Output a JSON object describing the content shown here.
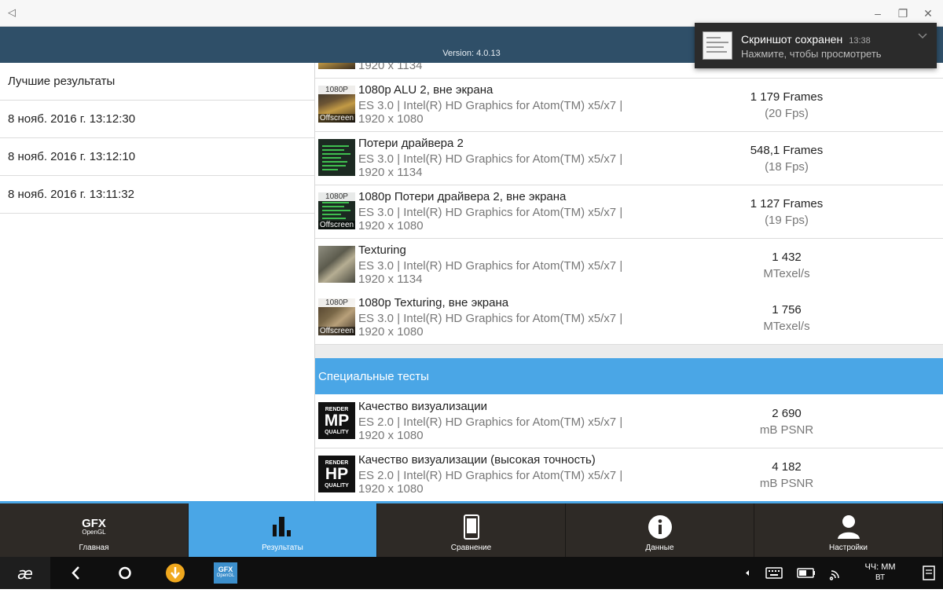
{
  "window": {
    "back_glyph": "◁",
    "minimize": "–",
    "restore": "❐",
    "close": "✕"
  },
  "header": {
    "version": "Version: 4.0.13"
  },
  "notification": {
    "title": "Скриншот сохранен",
    "time": "13:38",
    "subtitle": "Нажмите, чтобы просмотреть"
  },
  "sidebar": {
    "items": [
      {
        "label": "Лучшие результаты"
      },
      {
        "label": "8 нояб. 2016 г. 13:12:30"
      },
      {
        "label": "8 нояб. 2016 г. 13:12:10"
      },
      {
        "label": "8 нояб. 2016 г. 13:11:32"
      }
    ]
  },
  "tags": {
    "hd": "1080P",
    "offscreen": "Offscreen"
  },
  "results": [
    {
      "title": "",
      "spec": "",
      "res": "1920 x 1134",
      "value": "",
      "unit": ""
    },
    {
      "title": "1080p ALU 2, вне экрана",
      "spec": "ES 3.0 | Intel(R) HD Graphics for Atom(TM) x5/x7 |",
      "res": "1920 x 1080",
      "value": "1 179 Frames",
      "unit": "(20 Fps)"
    },
    {
      "title": "Потери драйвера 2",
      "spec": "ES 3.0 | Intel(R) HD Graphics for Atom(TM) x5/x7 |",
      "res": "1920 x 1134",
      "value": "548,1 Frames",
      "unit": "(18 Fps)"
    },
    {
      "title": "1080p Потери драйвера 2, вне экрана",
      "spec": "ES 3.0 | Intel(R) HD Graphics for Atom(TM) x5/x7 |",
      "res": "1920 x 1080",
      "value": "1 127 Frames",
      "unit": "(19 Fps)"
    },
    {
      "title": "Texturing",
      "spec": "ES 3.0 | Intel(R) HD Graphics for Atom(TM) x5/x7 |",
      "res": "1920 x 1134",
      "value": "1 432",
      "unit": "MTexel/s"
    },
    {
      "title": "1080p Texturing, вне экрана",
      "spec": "ES 3.0 | Intel(R) HD Graphics for Atom(TM) x5/x7 |",
      "res": "1920 x 1080",
      "value": "1 756",
      "unit": "MTexel/s"
    }
  ],
  "special_section": {
    "label": "Специальные тесты"
  },
  "special": [
    {
      "badge_top": "RENDER",
      "badge_big": "MP",
      "badge_bottom": "QUALITY",
      "title": "Качество визуализации",
      "spec": "ES 2.0 | Intel(R) HD Graphics for Atom(TM) x5/x7 |",
      "res": "1920 x 1080",
      "value": "2 690",
      "unit": "mB PSNR"
    },
    {
      "badge_top": "RENDER",
      "badge_big": "HP",
      "badge_bottom": "QUALITY",
      "title": "Качество визуализации (высокая точность)",
      "spec": "ES 2.0 | Intel(R) HD Graphics for Atom(TM) x5/x7 |",
      "res": "1920 x 1080",
      "value": "4 182",
      "unit": "mB PSNR"
    }
  ],
  "tabs": [
    {
      "label": "Главная",
      "logo_top": "GFX",
      "logo_bottom": "OpenGL"
    },
    {
      "label": "Результаты"
    },
    {
      "label": "Сравнение"
    },
    {
      "label": "Данные"
    },
    {
      "label": "Настройки"
    }
  ],
  "taskbar": {
    "app_tile_top": "GFX",
    "app_tile_bottom": "OpenGL",
    "clock_time": "ЧЧ: ММ",
    "clock_day": "ВТ"
  },
  "colors": {
    "accent": "#4aa6e6",
    "header": "#2f4f68",
    "tabbar": "#2e2a26"
  }
}
